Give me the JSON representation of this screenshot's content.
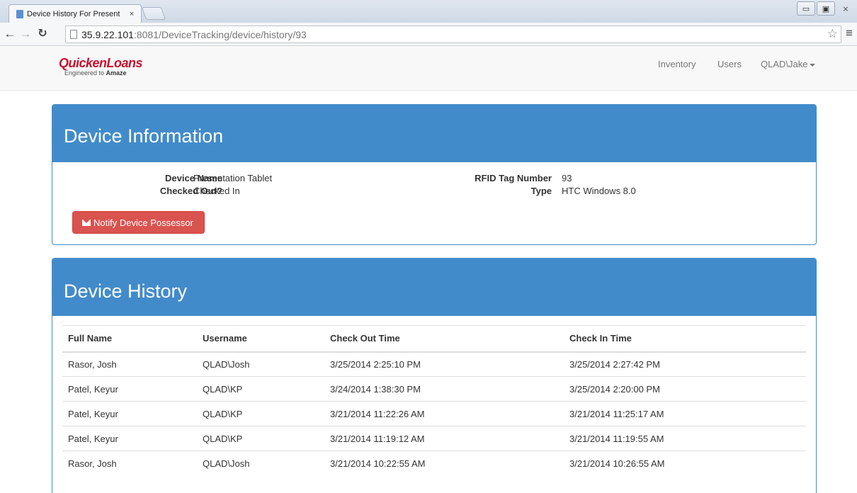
{
  "browser": {
    "tab_title": "Device History For Present",
    "tab_close": "×",
    "url_host": "35.9.22.101",
    "url_rest": ":8081/DeviceTracking/device/history/93",
    "window_controls": {
      "minimize": "▭",
      "maximize": "▣",
      "close": "⨯"
    }
  },
  "nav": {
    "logo_main": "QuickenLoans",
    "logo_sub_prefix": "Engineered to ",
    "logo_sub_bold": "Amaze",
    "links": [
      "Inventory",
      "Users"
    ],
    "user_menu": "QLAD\\Jake"
  },
  "device_info": {
    "title": "Device Information",
    "device_name_label": "Device Name",
    "device_name_value": "Presentation Tablet",
    "checked_out_label": "Checked Out?",
    "checked_out_value": "Checked In",
    "rfid_label": "RFID Tag Number",
    "rfid_value": "93",
    "type_label": "Type",
    "type_value": "HTC Windows 8.0",
    "notify_button": "Notify Device Possessor"
  },
  "device_history": {
    "title": "Device History",
    "columns": [
      "Full Name",
      "Username",
      "Check Out Time",
      "Check In Time"
    ],
    "rows": [
      [
        "Rasor, Josh",
        "QLAD\\Josh",
        "3/25/2014 2:25:10 PM",
        "3/25/2014 2:27:42 PM"
      ],
      [
        "Patel, Keyur",
        "QLAD\\KP",
        "3/24/2014 1:38:30 PM",
        "3/25/2014 2:20:00 PM"
      ],
      [
        "Patel, Keyur",
        "QLAD\\KP",
        "3/21/2014 11:22:26 AM",
        "3/21/2014 11:25:17 AM"
      ],
      [
        "Patel, Keyur",
        "QLAD\\KP",
        "3/21/2014 11:19:12 AM",
        "3/21/2014 11:19:55 AM"
      ],
      [
        "Rasor, Josh",
        "QLAD\\Josh",
        "3/21/2014 10:22:55 AM",
        "3/21/2014 10:26:55 AM"
      ]
    ]
  }
}
